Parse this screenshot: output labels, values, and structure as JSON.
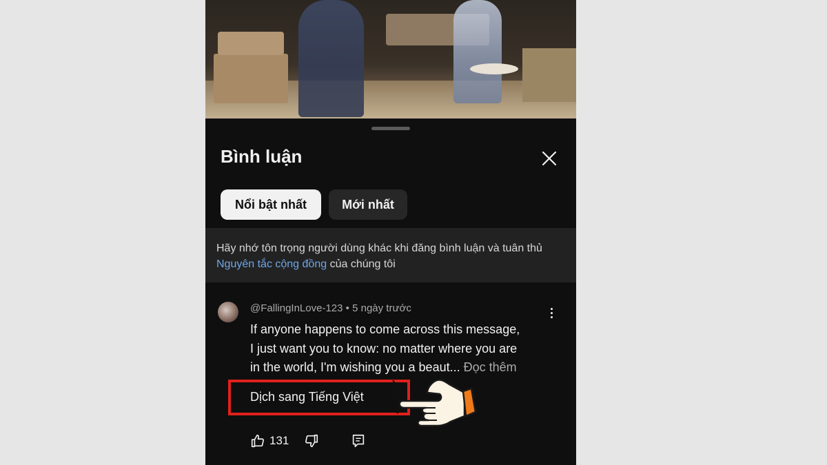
{
  "panel": {
    "title": "Bình luận"
  },
  "tabs": [
    {
      "label": "Nổi bật nhất",
      "active": true
    },
    {
      "label": "Mới nhất",
      "active": false
    }
  ],
  "notice": {
    "text_before": "Hãy nhớ tôn trọng người dùng khác khi đăng bình luận và tuân thủ ",
    "link_text": "Nguyên tắc cộng đồng",
    "text_after": " của chúng tôi"
  },
  "comment": {
    "author": "@FallingInLove-123",
    "separator": "•",
    "time": "5 ngày trước",
    "lines": [
      "If anyone happens to come across this message,",
      "I just want you to know: no matter where you are",
      "in the world, I'm wishing you a beaut..."
    ],
    "read_more": "Đọc thêm",
    "translate_label": "Dịch sang Tiếng Việt",
    "like_count": "131"
  },
  "icons": {
    "close": "close-icon",
    "more": "more-vert-icon",
    "like": "thumb-up-icon",
    "dislike": "thumb-down-icon",
    "reply": "reply-icon",
    "pointer": "pointing-hand-icon"
  },
  "colors": {
    "highlight": "#e0201b",
    "link": "#6fa6e8",
    "background": "#0f0f0f"
  }
}
